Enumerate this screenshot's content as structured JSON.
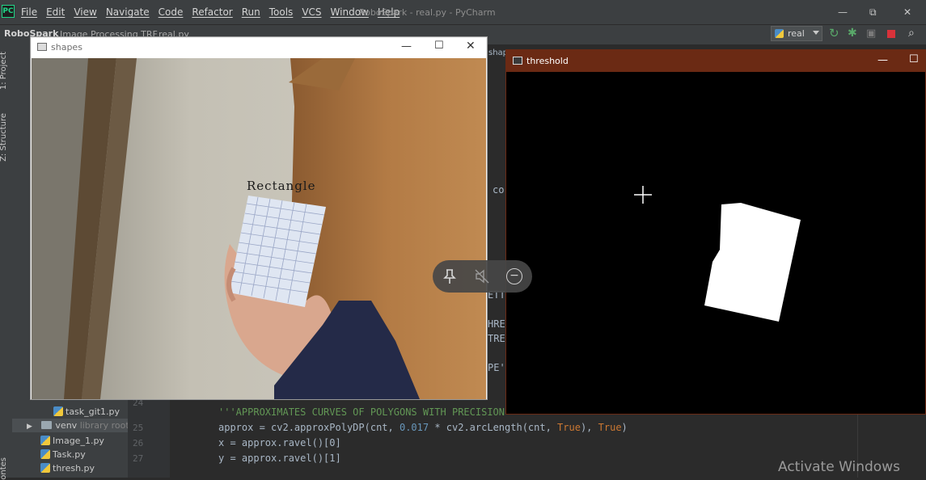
{
  "ide": {
    "menu": [
      "File",
      "Edit",
      "View",
      "Navigate",
      "Code",
      "Refactor",
      "Run",
      "Tools",
      "VCS",
      "Window",
      "Help"
    ],
    "title": "RoboSpark - real.py - PyCharm",
    "window_controls": {
      "minimize": "—",
      "maximize": "⧉",
      "close": "✕"
    },
    "breadcrumbs": {
      "project": "RoboSpark",
      "folder": "Image Processing TRF",
      "file": "real.py"
    },
    "run_config": "real",
    "colors": {
      "accent_green": "#59a869",
      "stop_red": "#d8323a",
      "panel": "#3c3f41",
      "editor": "#2b2b2b"
    }
  },
  "tool_tabs": {
    "project": "1: Project",
    "structure": "Z: Structure",
    "favorites": "ontes"
  },
  "project_tree": [
    {
      "label": "task_git1.py",
      "type": "py"
    },
    {
      "label": "venv",
      "sublabel": "library root",
      "type": "folder"
    },
    {
      "label": "Image_1.py",
      "type": "py"
    },
    {
      "label": "Task.py",
      "type": "py"
    },
    {
      "label": "thresh.py",
      "type": "py"
    }
  ],
  "editor": {
    "line_numbers": [
      "24",
      "25",
      "26",
      "27"
    ],
    "lines": {
      "l24_comment": "'''APPROXIMATES CURVES OF POLYGONS WITH PRECISION'",
      "l25_a": "approx = cv2.approxPolyDP(cnt, ",
      "l25_num": "0.017",
      "l25_b": " * cv2.arcLength(cnt, ",
      "l25_true1": "True",
      "l25_c": "), ",
      "l25_true2": "True",
      "l25_d": ")",
      "l26": "x = approx.ravel()[0]",
      "l27": "y = approx.ravel()[1]"
    },
    "fragments": [
      "shap",
      "co",
      "ETT",
      "HRE",
      "TRE",
      "PE'"
    ]
  },
  "shapes_window": {
    "title": "shapes",
    "detected_label": "Rectangle",
    "controls": {
      "minimize": "—",
      "maximize": "☐",
      "close": "✕"
    }
  },
  "threshold_window": {
    "title": "threshold",
    "controls": {
      "minimize": "—",
      "maximize": "☐"
    }
  },
  "overlay": {
    "pin": "pin-icon",
    "mute": "mute-icon",
    "minus": "minus-icon"
  },
  "watermark": "Activate Windows"
}
